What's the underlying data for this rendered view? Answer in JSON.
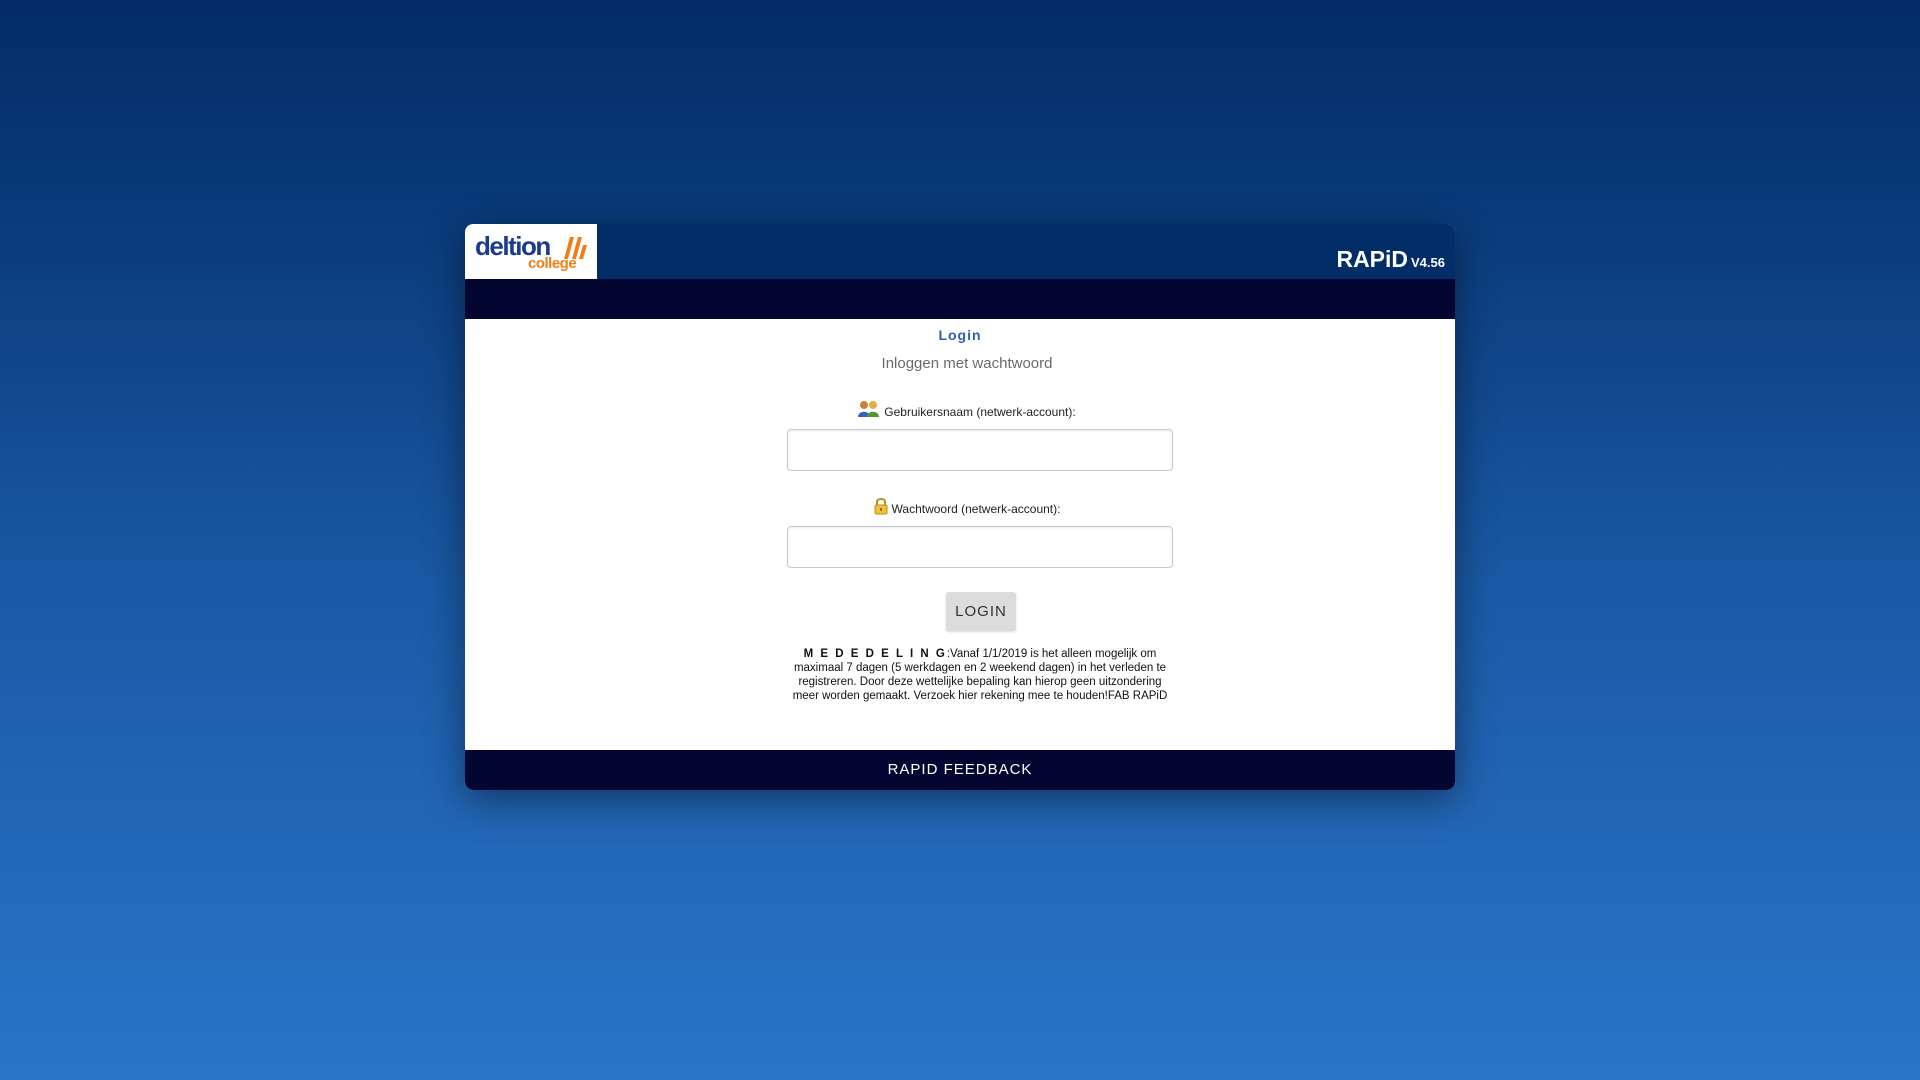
{
  "header": {
    "logo": {
      "word1": "deltion",
      "word2": "college"
    },
    "app_name": "RAPiD",
    "version": "V4.56"
  },
  "login": {
    "title": "Login",
    "subtitle": "Inloggen met wachtwoord",
    "username_label": "Gebruikersnaam (netwerk-account):",
    "username_value": "",
    "username_icon": "users-icon",
    "password_label": "Wachtwoord (netwerk-account):",
    "password_value": "",
    "password_icon": "lock-icon",
    "button_label": "LOGIN"
  },
  "notice": {
    "prefix": "M E D E D E L I N G",
    "text": ":Vanaf 1/1/2019 is het alleen mogelijk om maximaal 7 dagen (5 werkdagen en 2 weekend dagen) in het verleden te registreren. Door deze wettelijke bepaling kan hierop geen uitzondering meer worden gemaakt. Verzoek hier rekening mee te houden!FAB RAPiD"
  },
  "footer": {
    "label": "RAPID FEEDBACK"
  },
  "colors": {
    "header": "#022d67",
    "nav": "#020631",
    "link": "#2f5fb3",
    "logo_blue": "#1d3b8e",
    "logo_orange": "#f07d1a"
  }
}
